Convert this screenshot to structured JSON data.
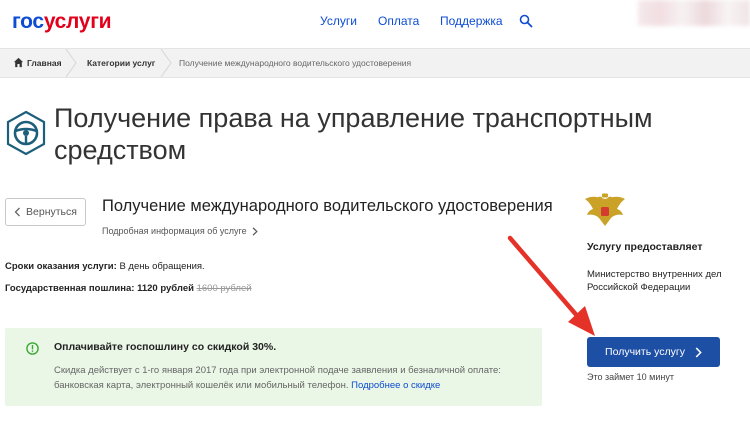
{
  "header": {
    "logo_part1": "гос",
    "logo_part2": "услуги",
    "nav": [
      "Услуги",
      "Оплата",
      "Поддержка"
    ],
    "search_icon": "search-icon"
  },
  "breadcrumb": {
    "items": [
      "Главная",
      "Категории услуг",
      "Получение международного водительского удостоверения"
    ]
  },
  "page": {
    "title": "Получение права на управление транспортным средством",
    "title_icon": "steering-wheel-icon"
  },
  "service": {
    "back_label": "Вернуться",
    "name": "Получение международного водительского удостоверения",
    "details_link": "Подробная информация об услуге",
    "term_label": "Сроки оказания услуги:",
    "term_value": "В день обращения.",
    "fee_label": "Государственная пошлина:",
    "fee_value": "1120 рублей",
    "fee_old": "1600 рублей"
  },
  "promo": {
    "title": "Оплачивайте госпошлину со скидкой 30%.",
    "text": "Скидка действует с 1-го января 2017 года при электронной подаче заявления и безналичной оплате: банковская карта, электронный кошелёк или мобильный телефон.",
    "link": "Подробнее о скидке",
    "background": "#eaf6e6",
    "icon": "check-circle-icon"
  },
  "provider": {
    "heading": "Услугу предоставляет",
    "name": "Министерство внутренних дел Российской Федерации",
    "emblem": "coat-of-arms-icon",
    "button_label": "Получить услугу",
    "eta": "Это займет 10 минут",
    "button_color": "#1d4fa4"
  },
  "annotation": {
    "arrow_color": "#e53228"
  }
}
